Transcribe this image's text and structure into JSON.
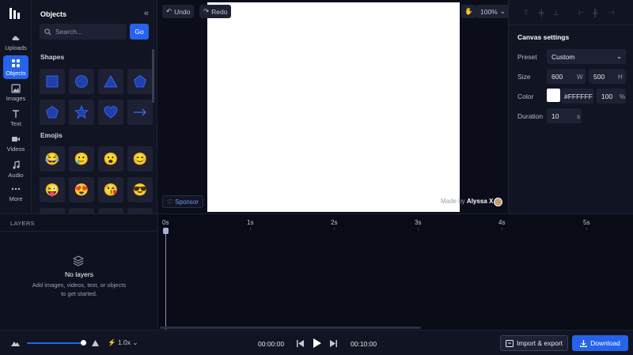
{
  "rail": {
    "items": [
      {
        "label": "Uploads",
        "icon": "cloud-upload-icon"
      },
      {
        "label": "Objects",
        "icon": "objects-icon",
        "active": true
      },
      {
        "label": "Images",
        "icon": "image-icon"
      },
      {
        "label": "Text",
        "icon": "text-icon"
      },
      {
        "label": "Videos",
        "icon": "video-icon"
      },
      {
        "label": "Audio",
        "icon": "music-icon"
      },
      {
        "label": "More",
        "icon": "more-icon"
      }
    ]
  },
  "objects_panel": {
    "title": "Objects",
    "search_placeholder": "Search...",
    "go_label": "Go",
    "shapes_label": "Shapes",
    "emojis_label": "Emojis",
    "shapes": [
      "square",
      "circle",
      "triangle",
      "pentagon",
      "pentagon-alt",
      "star",
      "heart",
      "arrow"
    ],
    "emojis": [
      "😂",
      "🥲",
      "😮",
      "😊",
      "😜",
      "😍",
      "😘",
      "😎"
    ]
  },
  "toolbar": {
    "undo_label": "Undo",
    "redo_label": "Redo",
    "zoom_label": "100%"
  },
  "canvas": {
    "sponsor_label": "Sponsor",
    "made_by_prefix": "Made by",
    "made_by_name": "Alyssa X"
  },
  "settings": {
    "title": "Canvas settings",
    "preset_label": "Preset",
    "preset_value": "Custom",
    "size_label": "Size",
    "width_value": "600",
    "width_unit": "W",
    "height_value": "500",
    "height_unit": "H",
    "color_label": "Color",
    "color_value": "#FFFFFF",
    "opacity_value": "100",
    "opacity_unit": "%",
    "duration_label": "Duration",
    "duration_value": "10",
    "duration_unit": "s"
  },
  "layers": {
    "header": "LAYERS",
    "empty_title": "No layers",
    "empty_subtitle": "Add images, videos, text, or objects to get started."
  },
  "timeline": {
    "ticks": [
      "0s",
      "1s",
      "2s",
      "3s",
      "4s",
      "5s"
    ]
  },
  "bottombar": {
    "speed_label": "1.0x",
    "current_time": "00:00:00",
    "total_time": "00:10:00",
    "import_label": "Import & export",
    "download_label": "Download"
  },
  "colors": {
    "accent": "#2563eb",
    "background": "#0b0d1a",
    "panel": "#111422",
    "shape_fill": "#1e40af"
  }
}
